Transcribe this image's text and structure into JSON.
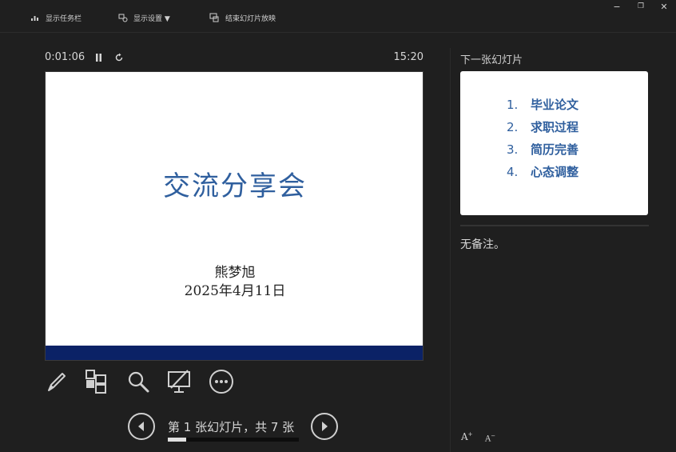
{
  "toolbar": {
    "taskbar_label": "显示任务栏",
    "settings_label": "显示设置 ▼",
    "end_show_label": "结束幻灯片放映"
  },
  "window": {
    "minimize": "−",
    "restore": "❐",
    "close": "✕"
  },
  "timer": {
    "elapsed": "0:01:06",
    "clock": "15:20"
  },
  "current_slide": {
    "title": "交流分享会",
    "author": "熊梦旭",
    "date": "2025年4月11日",
    "band_color": "#0b2266",
    "title_color": "#2f5f9e"
  },
  "navigation": {
    "counter": "第 1 张幻灯片，共 7 张",
    "current": 1,
    "total": 7
  },
  "next_slide": {
    "label": "下一张幻灯片",
    "items": [
      {
        "num": "1.",
        "text": "毕业论文"
      },
      {
        "num": "2.",
        "text": "求职过程"
      },
      {
        "num": "3.",
        "text": "简历完善"
      },
      {
        "num": "4.",
        "text": "心态调整"
      }
    ]
  },
  "notes": {
    "text": "无备注。"
  },
  "font_controls": {
    "increase": "A",
    "decrease": "A"
  },
  "icons": [
    "taskbar-icon",
    "display-settings-icon",
    "end-slideshow-icon",
    "pause-icon",
    "reset-icon",
    "pen-icon",
    "all-slides-icon",
    "zoom-icon",
    "black-screen-icon",
    "more-options-icon",
    "previous-icon",
    "next-icon"
  ]
}
